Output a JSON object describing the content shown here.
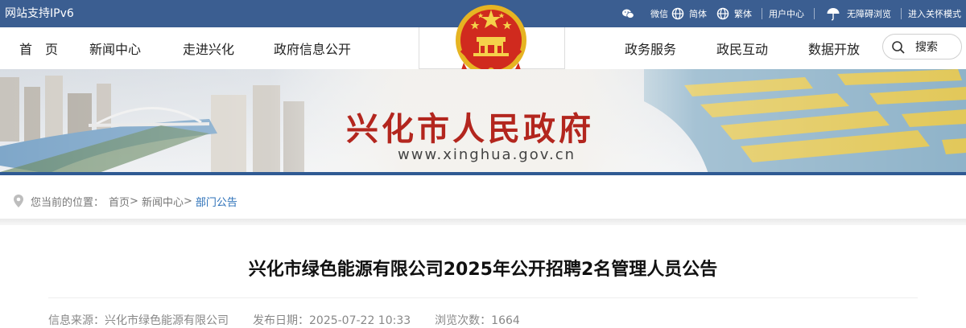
{
  "topbar": {
    "ipv6": "网站支持IPv6",
    "wechat": "微信",
    "simplified": "简体",
    "traditional": "繁体",
    "user_center": "用户中心",
    "accessibility": "无障碍浏览",
    "care_mode": "进入关怀模式",
    "bg_color": "#3b5e91"
  },
  "nav": {
    "home": "首　页",
    "news": "新闻中心",
    "about": "走进兴化",
    "info": "政府信息公开",
    "services": "政务服务",
    "interaction": "政民互动",
    "open_data": "数据开放",
    "search_label": "搜索"
  },
  "banner": {
    "title": "兴化市人民政府",
    "url": "www.xinghua.gov.cn",
    "title_color": "#b3261e"
  },
  "breadcrumb": {
    "prefix": "您当前的位置：",
    "home": "首页",
    "news": "新闻中心",
    "current": "部门公告",
    "sep": ">"
  },
  "article": {
    "title": "兴化市绿色能源有限公司2025年公开招聘2名管理人员公告",
    "source_label": "信息来源：",
    "source": "兴化市绿色能源有限公司",
    "date_label": "发布日期：",
    "date": "2025-07-22 10:33",
    "views_label": "浏览次数：",
    "views": "1664"
  }
}
